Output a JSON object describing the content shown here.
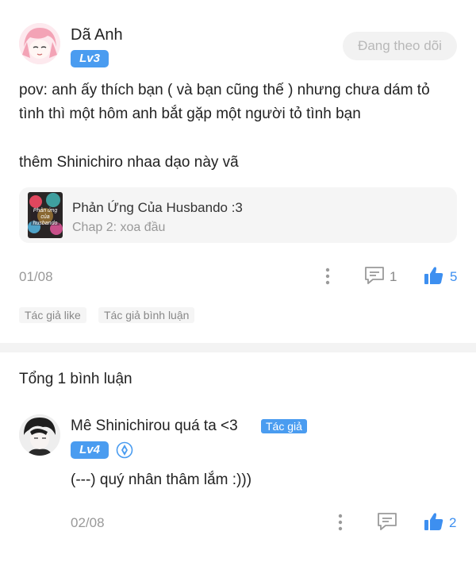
{
  "post": {
    "author": "Dã Anh",
    "level": "Lv3",
    "follow_label": "Đang theo dõi",
    "text_line1": "pov: anh ấy thích bạn ( và bạn cũng thế ) nhưng chưa dám tỏ",
    "text_line2": "tình thì một hôm anh bắt gặp một người tỏ tình bạn",
    "text_line3": "thêm Shinichiro nhaa dạo này vã",
    "card": {
      "title": "Phản Ứng Của Husbando :3",
      "subtitle": "Chap 2: xoa đầu",
      "thumb_text": "Phản ứng của husbando"
    },
    "date": "01/08",
    "comment_count": "1",
    "like_count": "5",
    "tags": [
      "Tác giả like",
      "Tác giả bình luận"
    ]
  },
  "comments": {
    "total_label": "Tổng 1 bình luận",
    "items": [
      {
        "author": "Mê Shinichirou quá ta <3",
        "role_badge": "Tác giả",
        "level": "Lv4",
        "text": "(---) quý nhân thâm lắm :)))",
        "date": "02/08",
        "like_count": "2"
      }
    ]
  },
  "colors": {
    "accent": "#4a9cf0",
    "muted": "#999999"
  }
}
